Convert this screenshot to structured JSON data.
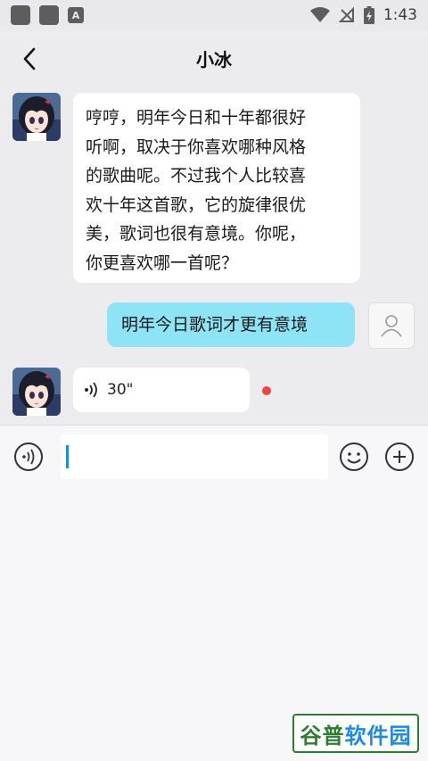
{
  "status_bar": {
    "time": "1:43",
    "a_label": "A"
  },
  "header": {
    "title": "小冰"
  },
  "messages": [
    {
      "from": "bot",
      "lines": [
        "哼哼，明年今日和十年都很好",
        "听啊，取决于你喜欢哪种风格",
        "的歌曲呢。不过我个人比较喜",
        "欢十年这首歌，它的旋律很优",
        "美，歌词也很有意境。你呢，",
        "你更喜欢哪一首呢？"
      ]
    },
    {
      "from": "user",
      "text": "明年今日歌词才更有意境"
    },
    {
      "from": "bot",
      "type": "voice",
      "duration": "30\""
    }
  ],
  "input": {
    "value": "",
    "placeholder": ""
  },
  "watermark": {
    "brand_part1": "谷普",
    "brand_part2": "软件园"
  },
  "colors": {
    "user_bubble": "#8ee3f5",
    "unread_dot": "#f14545",
    "caret": "#1f8fd6"
  }
}
